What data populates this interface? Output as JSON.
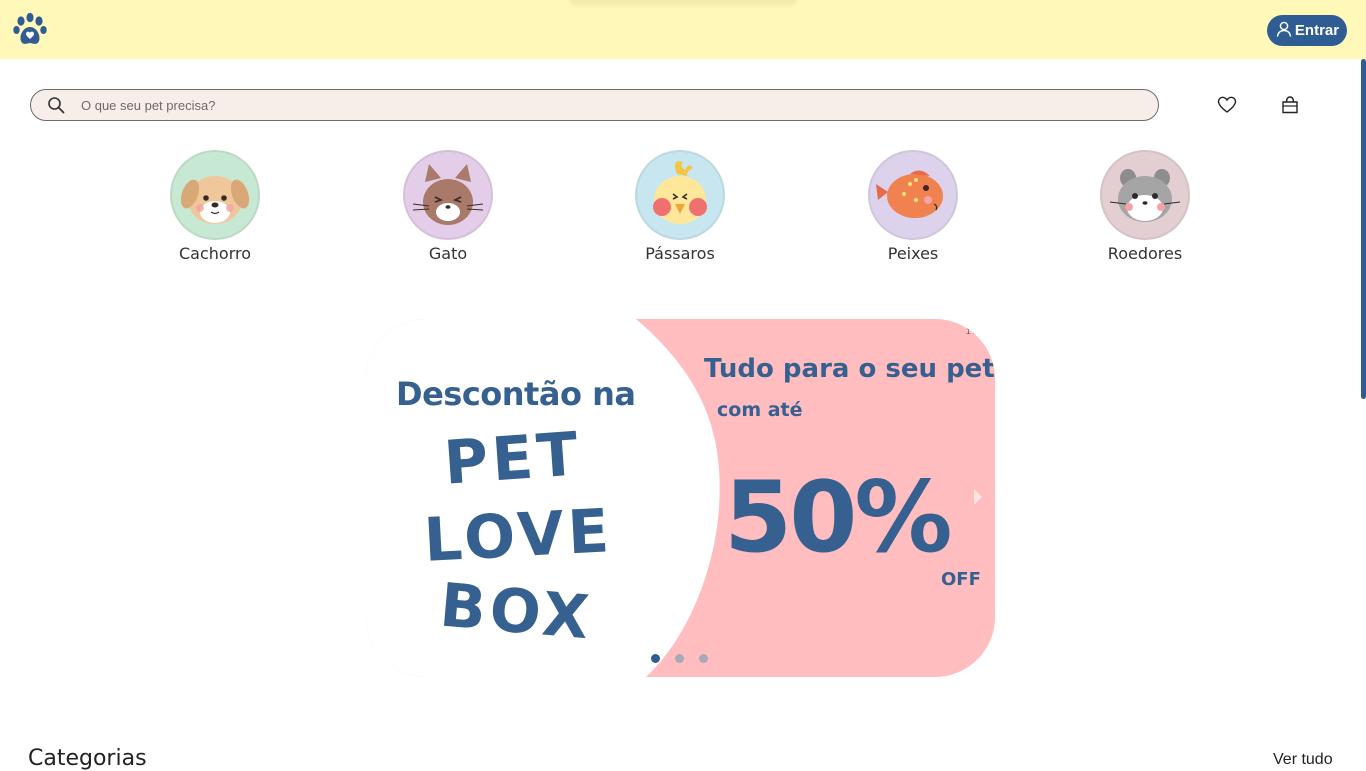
{
  "header": {
    "logo_icon": "paw-icon",
    "login_label": "Entrar",
    "login_icon": "user-icon"
  },
  "search": {
    "placeholder": "O que seu pet precisa?",
    "icon": "search-icon"
  },
  "actions": {
    "favorites_icon": "heart-icon",
    "cart_icon": "shopping-bag-icon"
  },
  "pets": [
    {
      "label": "Cachorro",
      "icon": "dog-icon",
      "color": "#c7e8d2"
    },
    {
      "label": "Gato",
      "icon": "cat-icon",
      "color": "#e3cde8"
    },
    {
      "label": "Pássaros",
      "icon": "bird-icon",
      "color": "#c8e6f0"
    },
    {
      "label": "Peixes",
      "icon": "fish-icon",
      "color": "#dcd2ec"
    },
    {
      "label": "Roedores",
      "icon": "hamster-icon",
      "color": "#e3cfd1"
    }
  ],
  "banner": {
    "counter": "1 of 3",
    "left_title": "Descontão na",
    "brand_line1": "PET",
    "brand_line2": "LOVE",
    "brand_line3": "BOX",
    "right_title": "Tudo para o seu pet",
    "right_sub": "com até",
    "discount": "50%",
    "discount_suffix": "OFF",
    "slides_total": 3,
    "active_slide": 1
  },
  "categories": {
    "title": "Categorias",
    "see_all": "Ver tudo"
  },
  "colors": {
    "header_bg": "#fff8b8",
    "brand_blue": "#2f5d93",
    "banner_pink": "#ffbdc0",
    "search_bg": "#f7eeea"
  }
}
